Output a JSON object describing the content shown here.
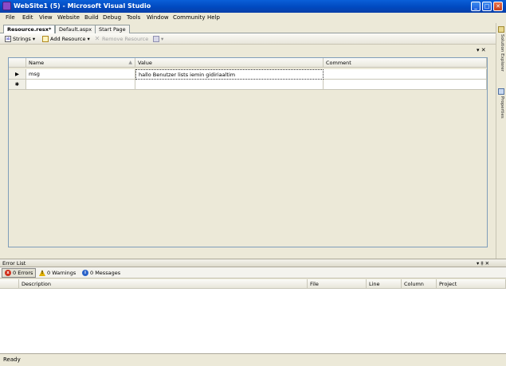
{
  "window": {
    "title": "WebSite1 (5) - Microsoft Visual Studio",
    "min": "_",
    "max": "□",
    "close": "✕"
  },
  "menu": [
    "File",
    "Edit",
    "View",
    "Website",
    "Build",
    "Debug",
    "Tools",
    "Window",
    "Community",
    "Help"
  ],
  "doc_tabs": [
    {
      "label": "Resource.resx*",
      "active": true
    },
    {
      "label": "Default.aspx",
      "active": false
    },
    {
      "label": "Start Page",
      "active": false
    }
  ],
  "doc_controls": "▾ ✕",
  "resource_toolbar": {
    "strings_label": "Strings ▾",
    "add_resource_label": "Add Resource ▾",
    "remove_resource_label": "Remove Resource",
    "view_label": "▾"
  },
  "grid": {
    "columns": [
      "Name",
      "Value",
      "Comment"
    ],
    "rows": [
      {
        "marker": "▶",
        "name": "msg",
        "value": "hallo Benutzer lists iemin gidiriaaltim",
        "comment": ""
      },
      {
        "marker": "✱",
        "name": "",
        "value": "",
        "comment": ""
      }
    ]
  },
  "sidebar_tabs": [
    "Solution Explorer",
    "Properties"
  ],
  "error_list": {
    "title": "Error List",
    "controls": "▾ ‡ ✕",
    "filters": [
      {
        "label": "0 Errors",
        "icon": "x",
        "color": "#d0301c"
      },
      {
        "label": "0 Warnings",
        "icon": "!",
        "color": "#e0b000"
      },
      {
        "label": "0 Messages",
        "icon": "i",
        "color": "#2a62c8"
      }
    ],
    "columns": [
      "",
      "Description",
      "File",
      "Line",
      "Column",
      "Project"
    ]
  },
  "status": "Ready"
}
